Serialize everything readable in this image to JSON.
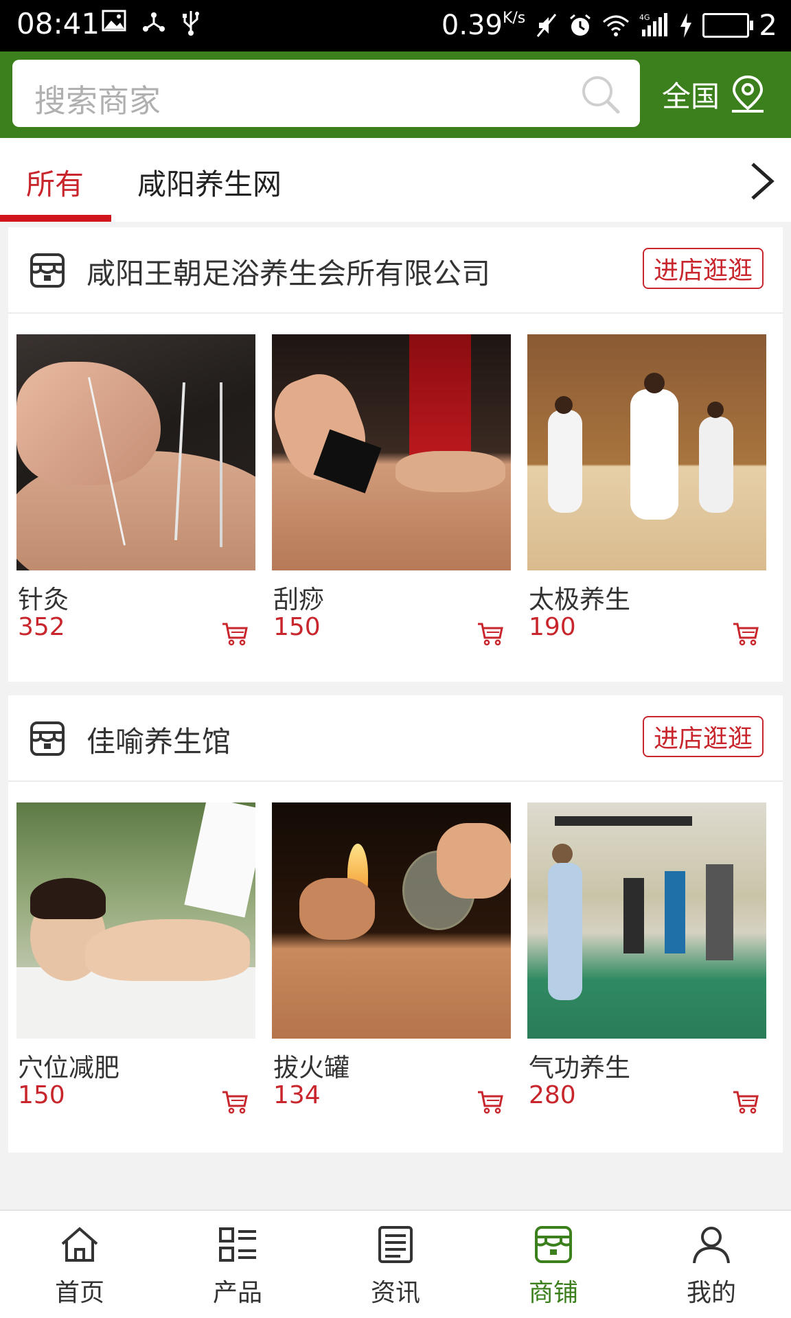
{
  "status_bar": {
    "time": "08:41",
    "speed": "0.39",
    "speed_unit": "K/s",
    "sim_number": "2",
    "network": "4G"
  },
  "search": {
    "placeholder": "搜索商家",
    "region_label": "全国"
  },
  "tabs": [
    {
      "label": "所有",
      "active": true
    },
    {
      "label": "咸阳养生网",
      "active": false
    }
  ],
  "shops": [
    {
      "name": "咸阳王朝足浴养生会所有限公司",
      "enter_label": "进店逛逛",
      "products": [
        {
          "name": "针灸",
          "price": "352"
        },
        {
          "name": "刮痧",
          "price": "150"
        },
        {
          "name": "太极养生",
          "price": "190"
        }
      ]
    },
    {
      "name": "佳喻养生馆",
      "enter_label": "进店逛逛",
      "products": [
        {
          "name": "穴位减肥",
          "price": "150"
        },
        {
          "name": "拔火罐",
          "price": "134"
        },
        {
          "name": "气功养生",
          "price": "280"
        }
      ]
    }
  ],
  "bottom_nav": [
    {
      "label": "首页",
      "icon": "home-icon",
      "active": false
    },
    {
      "label": "产品",
      "icon": "list-icon",
      "active": false
    },
    {
      "label": "资讯",
      "icon": "news-icon",
      "active": false
    },
    {
      "label": "商铺",
      "icon": "store-icon",
      "active": true
    },
    {
      "label": "我的",
      "icon": "user-icon",
      "active": false
    }
  ],
  "colors": {
    "header_green": "#3c7f1d",
    "accent_red": "#c8262c",
    "background": "#f2f2f2"
  }
}
